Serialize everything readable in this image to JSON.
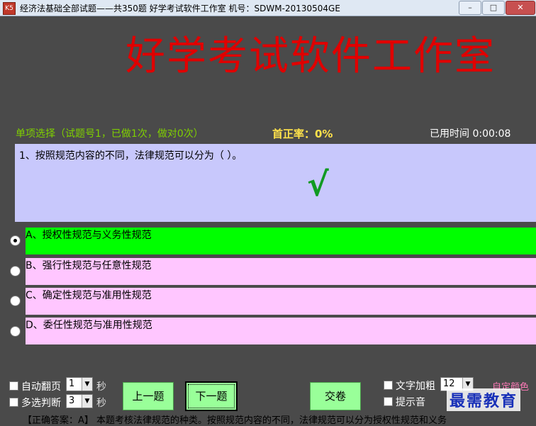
{
  "window": {
    "title": "经济法基础全部试题——共350题   好学考试软件工作室   机号：SDWM-20130504GE",
    "icon_text": "K5"
  },
  "banner": "好学考试软件工作室",
  "status": {
    "question_info": "单项选择（试题号1，已做1次，做对0次）",
    "accuracy": "首正率：0%",
    "elapsed": "已用时间 0:00:08"
  },
  "question": {
    "text": "1、按照规范内容的不同，法律规范可以分为（ ）。",
    "check_mark": "√"
  },
  "options": [
    {
      "text": "A、授权性规范与义务性规范",
      "selected": true
    },
    {
      "text": "B、强行性规范与任意性规范",
      "selected": false
    },
    {
      "text": "C、确定性规范与准用性规范",
      "selected": false
    },
    {
      "text": "D、委任性规范与准用性规范",
      "selected": false
    }
  ],
  "controls": {
    "auto_page_label": "自动翻页",
    "auto_page_value": "1",
    "auto_page_unit": "秒",
    "multi_judge_label": "多选判断",
    "multi_judge_value": "3",
    "multi_judge_unit": "秒",
    "prev_label": "上一题",
    "next_label": "下一题",
    "submit_label": "交卷",
    "bold_label": "文字加粗",
    "font_size_value": "12",
    "sound_label": "提示音",
    "custom_color_label": "自定颜色"
  },
  "answer_line": "【正确答案：A】   本题考核法律规范的种类。按照规范内容的不同，法律规范可以分为授权性规范和义务",
  "watermark": "最需教育",
  "colors": {
    "background": "#4a4a4a",
    "banner": "#e00000",
    "question_bg": "#c8c8fc",
    "option_bg": "#ffc6ff",
    "option_selected": "#00ff00",
    "button_bg": "#99ff99"
  }
}
